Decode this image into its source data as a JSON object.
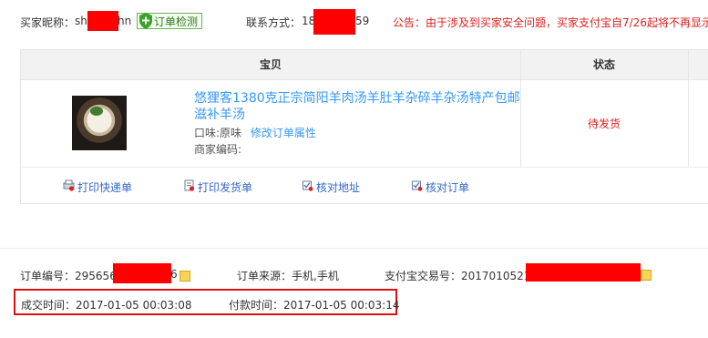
{
  "header": {
    "buyer_label": "买家昵称：",
    "buyer_prefix": "sh",
    "buyer_suffix": "hn",
    "check_button": "订单检测",
    "contact_label": "联系方式：",
    "contact_prefix": "18",
    "contact_suffix": "59",
    "notice": "公告：由于涉及到买家安全问题，买家支付宝自7/26起将不再显示"
  },
  "table": {
    "col_item": "宝贝",
    "col_status": "状态",
    "product_title": "悠狸客1380克正宗简阳羊肉汤羊肚羊杂碎羊杂汤特产包邮滋补羊汤",
    "flavor_label": "口味:原味",
    "edit_props_link": "修改订单属性",
    "merchant_code_label": "商家编码:",
    "status": "待发货"
  },
  "actions": [
    {
      "label": "打印快递单",
      "icon": "print-express-icon"
    },
    {
      "label": "打印发货单",
      "icon": "print-invoice-icon"
    },
    {
      "label": "核对地址",
      "icon": "verify-address-icon"
    },
    {
      "label": "核对订单",
      "icon": "verify-order-icon"
    }
  ],
  "order_info": {
    "order_no_label": "订单编号：",
    "order_no_prefix": "295656",
    "order_no_suffix": "6",
    "source_label": "订单来源：",
    "source_value": "手机,手机",
    "alipay_label": "支付宝交易号：",
    "alipay_prefix": "2017010521"
  },
  "times": {
    "deal_label": "成交时间：",
    "deal_value": "2017-01-05 00:03:08",
    "pay_label": "付款时间：",
    "pay_value": "2017-01-05 00:03:14"
  },
  "colors": {
    "link": "#3399ff",
    "alert": "#e02020",
    "redaction": "#ff0000",
    "highlight_box": "#e01010"
  }
}
